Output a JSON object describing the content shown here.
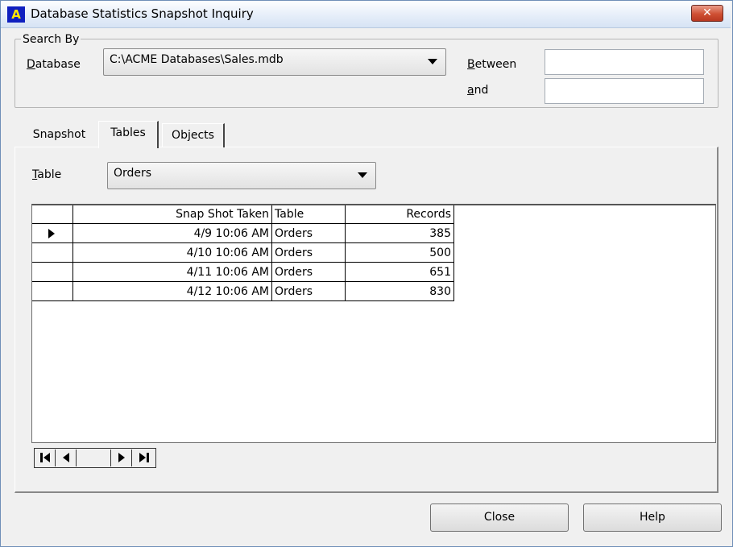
{
  "window": {
    "title": "Database Statistics Snapshot Inquiry",
    "app_logo_text": "A",
    "close_glyph": "✕"
  },
  "search": {
    "group_label": "Search By",
    "database_label_accel": "D",
    "database_label_rest": "atabase",
    "database_value": "C:\\ACME Databases\\Sales.mdb",
    "between_label_accel": "B",
    "between_label_rest": "etween",
    "between_value": "",
    "and_label_accel": "a",
    "and_label_rest": "nd",
    "and_value": ""
  },
  "tabs": {
    "snapshot": "Snapshot",
    "tables": "Tables",
    "objects": "Objects",
    "active": "Tables"
  },
  "table_filter": {
    "label_accel": "T",
    "label_rest": "able",
    "value": "Orders"
  },
  "grid": {
    "columns": [
      "Snap Shot Taken",
      "Table",
      "Records"
    ],
    "rows": [
      {
        "snapshot": "4/9 10:06 AM",
        "table": "Orders",
        "records": "385",
        "current": true
      },
      {
        "snapshot": "4/10 10:06 AM",
        "table": "Orders",
        "records": "500",
        "current": false
      },
      {
        "snapshot": "4/11 10:06 AM",
        "table": "Orders",
        "records": "651",
        "current": false
      },
      {
        "snapshot": "4/12 10:06 AM",
        "table": "Orders",
        "records": "830",
        "current": false
      }
    ]
  },
  "navigator": {
    "first_icon": "first-record-icon",
    "prev_icon": "previous-record-icon",
    "next_icon": "next-record-icon",
    "last_icon": "last-record-icon"
  },
  "buttons": {
    "close": "Close",
    "help": "Help"
  },
  "colors": {
    "close_button": "#cf5033",
    "logo_background": "#0f1fbf",
    "logo_text": "#ffe500"
  }
}
